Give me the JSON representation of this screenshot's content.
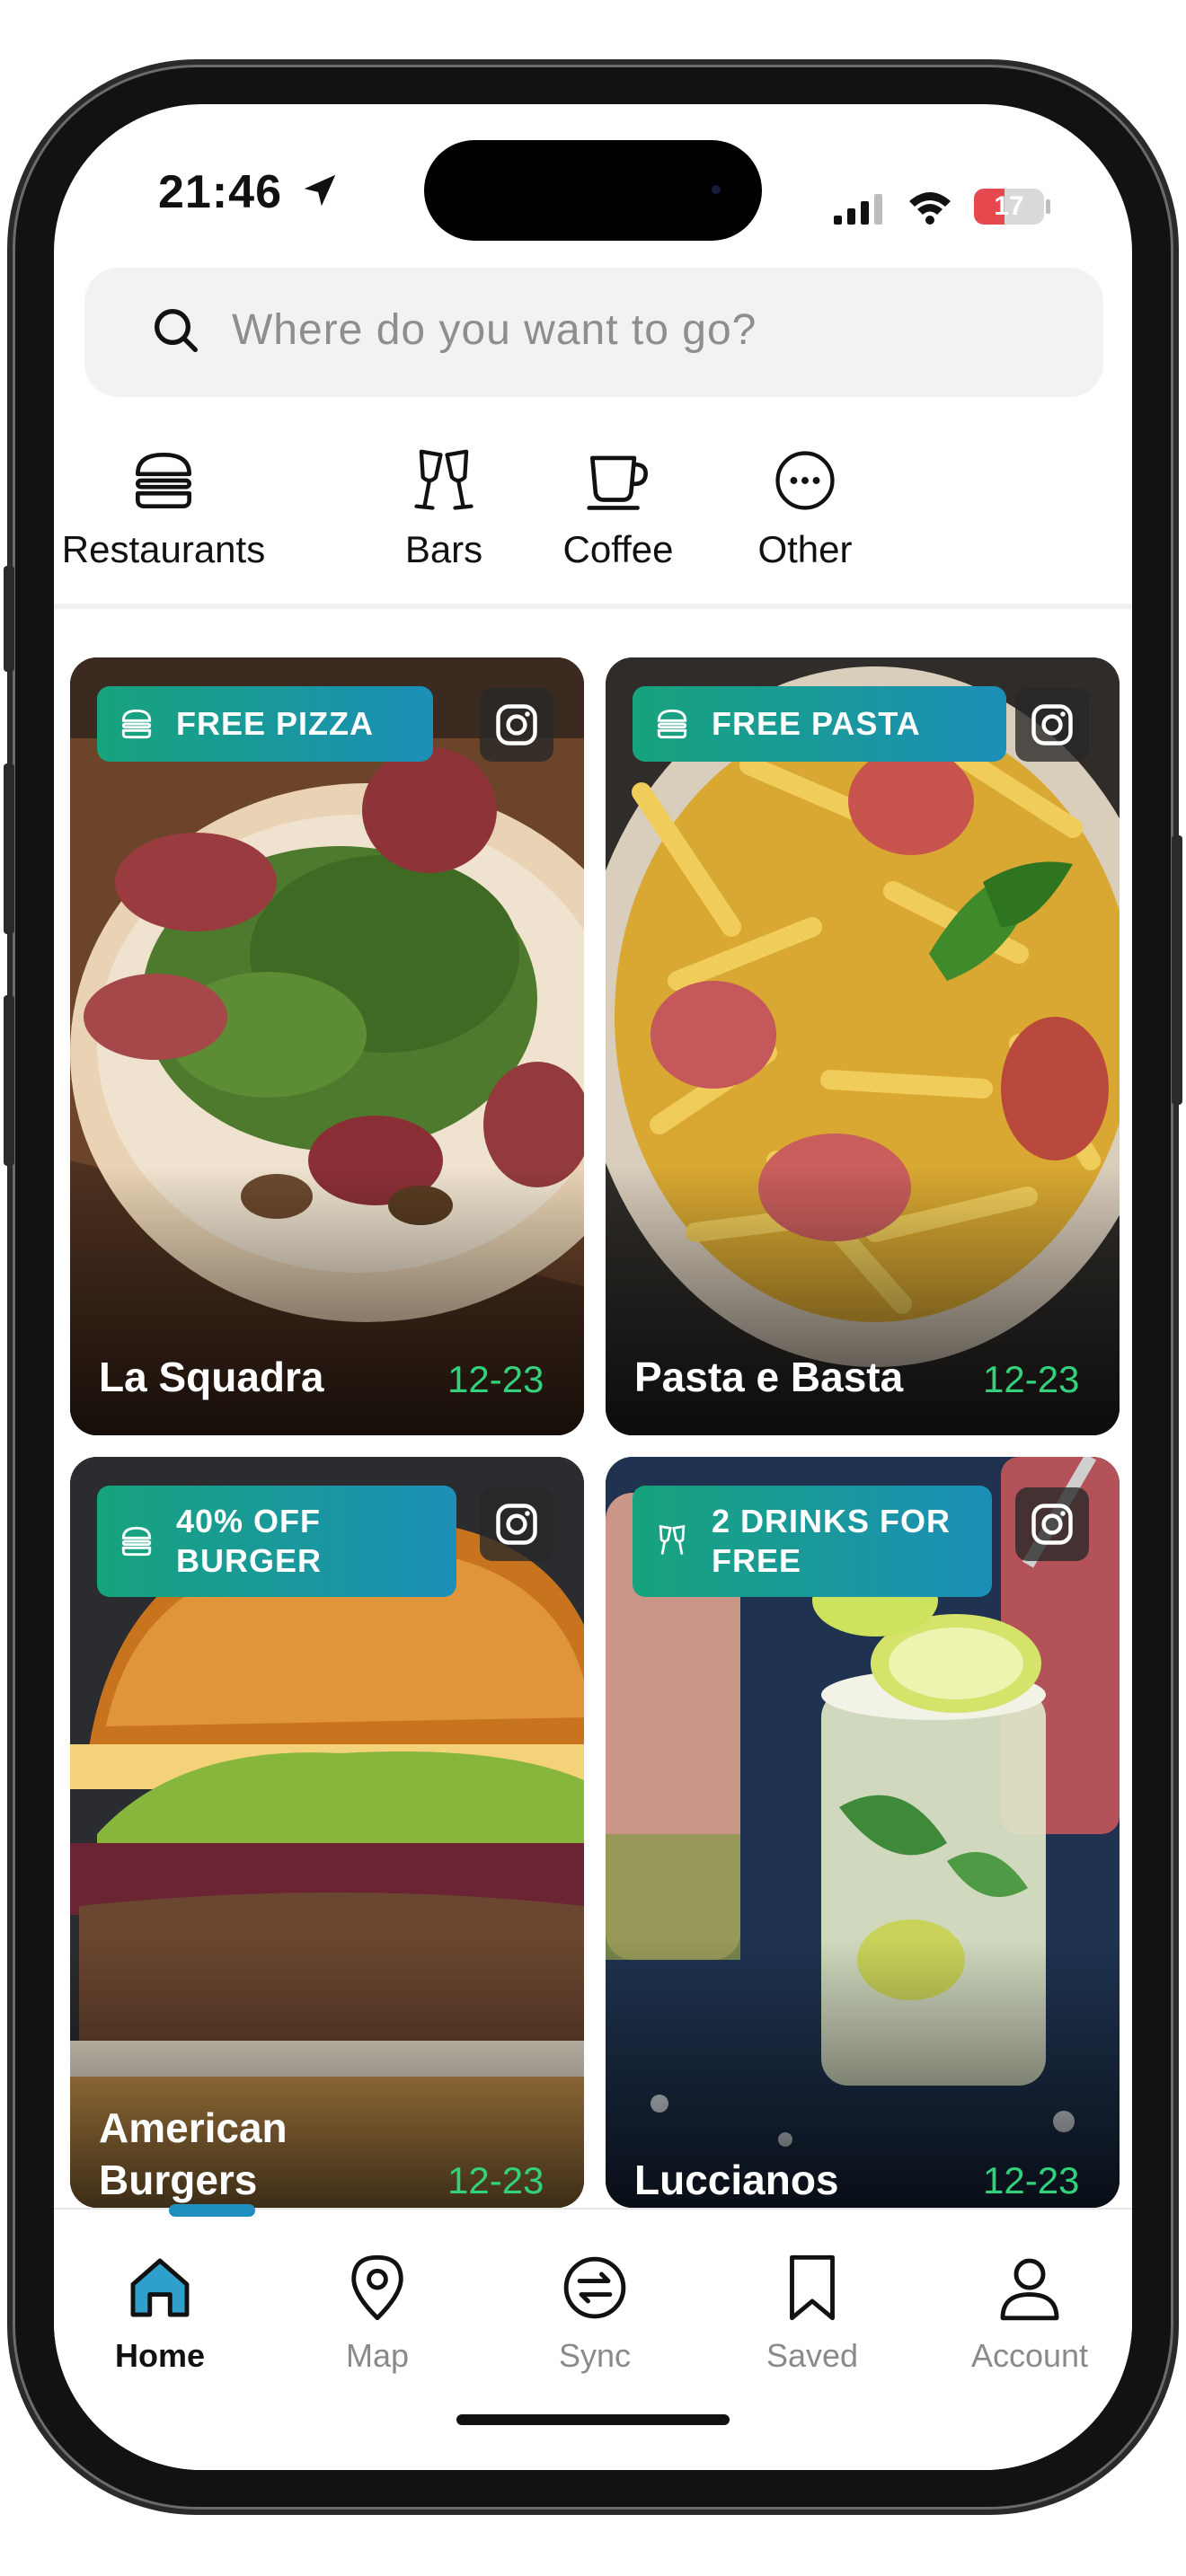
{
  "status_bar": {
    "time": "21:46",
    "battery": "17"
  },
  "search": {
    "placeholder": "Where do you want to go?"
  },
  "categories": [
    {
      "label": "Restaurants",
      "icon": "burger-icon"
    },
    {
      "label": "Bars",
      "icon": "cheers-icon"
    },
    {
      "label": "Coffee",
      "icon": "coffee-cup-icon"
    },
    {
      "label": "Other",
      "icon": "more-icon"
    }
  ],
  "cards": [
    {
      "badge": "FREE PIZZA",
      "badge_icon": "burger-icon",
      "name": "La Squadra",
      "date": "12-23"
    },
    {
      "badge": "FREE PASTA",
      "badge_icon": "burger-icon",
      "name": "Pasta e Basta",
      "date": "12-23"
    },
    {
      "badge_line1": "40% OFF",
      "badge_line2": "BURGER",
      "badge_icon": "burger-icon",
      "name_line1": "American",
      "name_line2": "Burgers",
      "date": "12-23"
    },
    {
      "badge_line1": "2 DRINKS FOR",
      "badge_line2": "FREE",
      "badge_icon": "cheers-icon",
      "name": "Luccianos",
      "date": "12-23"
    }
  ],
  "tabbar": [
    {
      "label": "Home",
      "icon": "home-icon",
      "active": true
    },
    {
      "label": "Map",
      "icon": "map-pin-icon"
    },
    {
      "label": "Sync",
      "icon": "sync-icon"
    },
    {
      "label": "Saved",
      "icon": "bookmark-icon"
    },
    {
      "label": "Account",
      "icon": "user-icon"
    }
  ],
  "colors": {
    "badge_start": "#17a37c",
    "badge_end": "#1c8fb8",
    "date_green": "#34d17c",
    "accent_blue": "#1f8fc0"
  }
}
